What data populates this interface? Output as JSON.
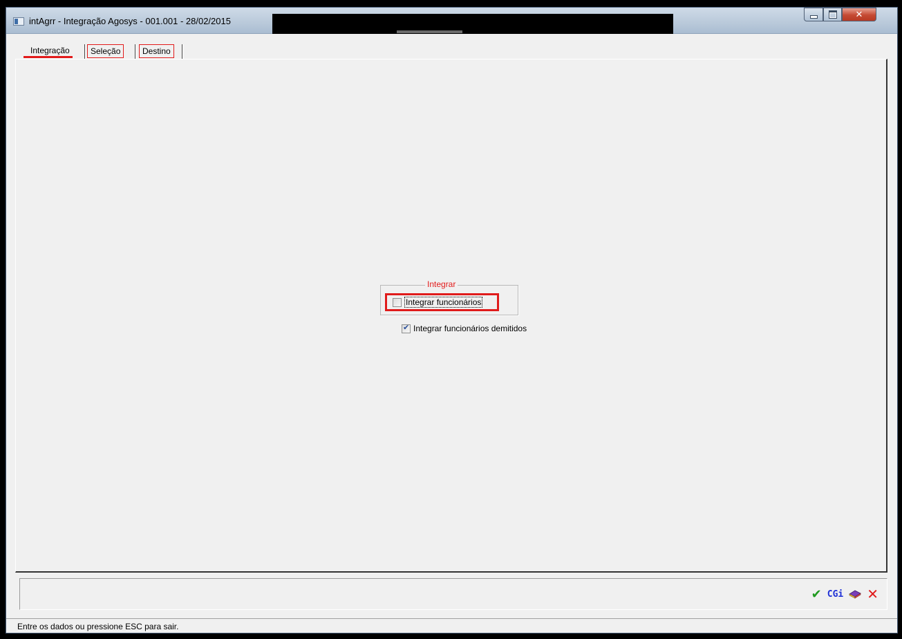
{
  "window": {
    "title": "intAgrr - Integração Agosys - 001.001 - 28/02/2015",
    "app_icon": "window-app-icon",
    "controls": {
      "minimize": "minimize-icon",
      "maximize": "maximize-icon",
      "close": "✕"
    }
  },
  "tabs": [
    {
      "label": "Integração",
      "active": true
    },
    {
      "label": "Seleção",
      "active": false
    },
    {
      "label": "Destino",
      "active": false
    }
  ],
  "integrar_group": {
    "legend": "Integrar",
    "integrar_funcionarios": {
      "label": "Integrar funcionários",
      "checked": false
    }
  },
  "integrar_demitidos": {
    "label": "Integrar funcionários demitidos",
    "checked": true
  },
  "actions": {
    "ok_icon": "✔",
    "cgi_label": "CGi",
    "book_icon": "book-icon",
    "cancel_icon": "✕"
  },
  "status": {
    "text": "Entre os dados ou pressione ESC para sair."
  },
  "colors": {
    "highlight": "#e21a1a",
    "ok": "#1f9a1f",
    "cgi": "#1d2fd6"
  }
}
